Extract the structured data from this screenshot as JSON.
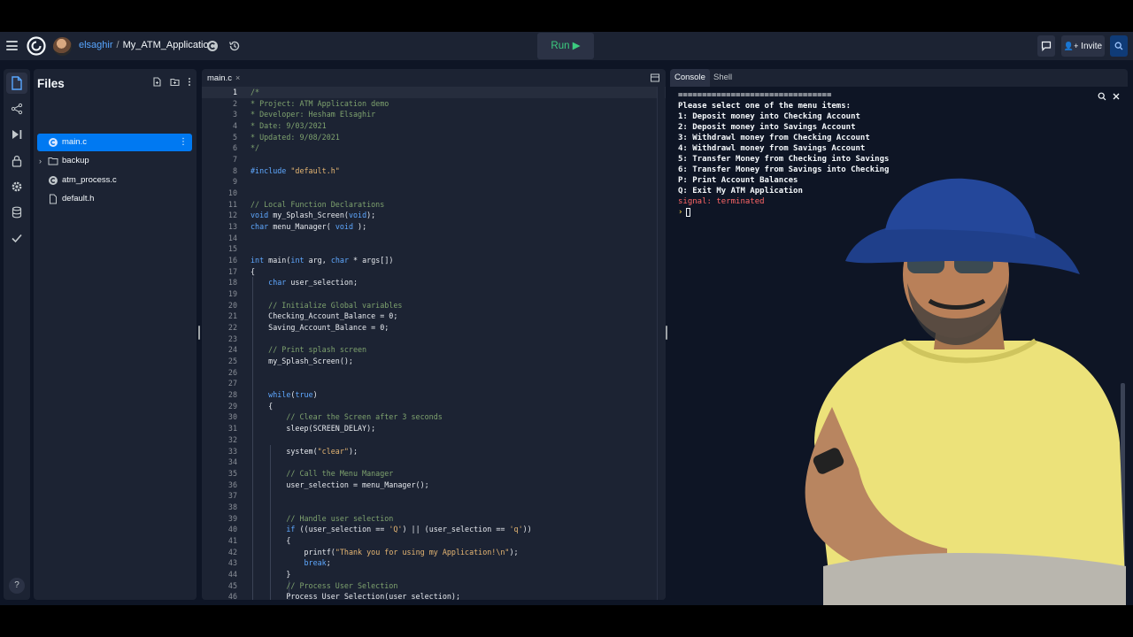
{
  "header": {
    "username": "elsaghir",
    "separator": "/",
    "project": "My_ATM_Application",
    "run_label": "Run ▶",
    "invite_label": "Invite"
  },
  "files": {
    "title": "Files",
    "items": [
      {
        "name": "main.c",
        "type": "c-file",
        "active": true
      },
      {
        "name": "backup",
        "type": "folder",
        "active": false
      },
      {
        "name": "atm_process.c",
        "type": "c-file",
        "active": false
      },
      {
        "name": "default.h",
        "type": "file",
        "active": false
      }
    ]
  },
  "help_label": "?",
  "editor": {
    "tab": "main.c",
    "tab_close": "×",
    "current_line": 1,
    "lines": [
      {
        "n": 1,
        "t": "/*",
        "c": true
      },
      {
        "n": 2,
        "t": "* Project: ATM Application demo",
        "c": true
      },
      {
        "n": 3,
        "t": "* Developer: Hesham Elsaghir",
        "c": true
      },
      {
        "n": 4,
        "t": "* Date: 9/03/2021",
        "c": true
      },
      {
        "n": 5,
        "t": "* Updated: 9/08/2021",
        "c": true
      },
      {
        "n": 6,
        "t": "*/",
        "c": true
      },
      {
        "n": 7,
        "t": ""
      },
      {
        "n": 8,
        "t": "#include \"default.h\"",
        "h": [
          [
            "#include",
            "#5fa8ff"
          ],
          [
            " ",
            ""
          ],
          [
            "\"default.h\"",
            "#e6b673"
          ]
        ]
      },
      {
        "n": 9,
        "t": ""
      },
      {
        "n": 10,
        "t": ""
      },
      {
        "n": 11,
        "t": "// Local Function Declarations",
        "c": true
      },
      {
        "n": 12,
        "t": "void my_Splash_Screen(void);",
        "h": [
          [
            "void",
            "#5fa8ff"
          ],
          [
            " my_Splash_Screen(",
            ""
          ],
          [
            "void",
            "#5fa8ff"
          ],
          [
            ");",
            ""
          ]
        ]
      },
      {
        "n": 13,
        "t": "char menu_Manager( void );",
        "h": [
          [
            "char",
            "#5fa8ff"
          ],
          [
            " menu_Manager( ",
            ""
          ],
          [
            "void",
            "#5fa8ff"
          ],
          [
            " );",
            ""
          ]
        ]
      },
      {
        "n": 14,
        "t": ""
      },
      {
        "n": 15,
        "t": ""
      },
      {
        "n": 16,
        "t": "int main(int arg, char * args[])",
        "h": [
          [
            "int",
            "#5fa8ff"
          ],
          [
            " main(",
            ""
          ],
          [
            "int",
            "#5fa8ff"
          ],
          [
            " arg, ",
            ""
          ],
          [
            "char",
            "#5fa8ff"
          ],
          [
            " * args[])",
            ""
          ]
        ]
      },
      {
        "n": 17,
        "t": "{"
      },
      {
        "n": 18,
        "t": "    char user_selection;",
        "h": [
          [
            "    ",
            ""
          ],
          [
            "char",
            "#5fa8ff"
          ],
          [
            " user_selection;",
            ""
          ]
        ]
      },
      {
        "n": 19,
        "t": ""
      },
      {
        "n": 20,
        "t": "    // Initialize Global variables",
        "c": true
      },
      {
        "n": 21,
        "t": "    Checking_Account_Balance = 0;"
      },
      {
        "n": 22,
        "t": "    Saving_Account_Balance = 0;"
      },
      {
        "n": 23,
        "t": ""
      },
      {
        "n": 24,
        "t": "    // Print splash screen",
        "c": true
      },
      {
        "n": 25,
        "t": "    my_Splash_Screen();"
      },
      {
        "n": 26,
        "t": ""
      },
      {
        "n": 27,
        "t": ""
      },
      {
        "n": 28,
        "t": "    while(true)",
        "h": [
          [
            "    ",
            ""
          ],
          [
            "while",
            "#5fa8ff"
          ],
          [
            "(",
            ""
          ],
          [
            "true",
            "#5fa8ff"
          ],
          [
            ")",
            ""
          ]
        ]
      },
      {
        "n": 29,
        "t": "    {"
      },
      {
        "n": 30,
        "t": "        // Clear the Screen after 3 seconds",
        "c": true
      },
      {
        "n": 31,
        "t": "        sleep(SCREEN_DELAY);"
      },
      {
        "n": 32,
        "t": ""
      },
      {
        "n": 33,
        "t": "        system(\"clear\");",
        "h": [
          [
            "        system(",
            ""
          ],
          [
            "\"clear\"",
            "#e6b673"
          ],
          [
            ");",
            ""
          ]
        ]
      },
      {
        "n": 34,
        "t": ""
      },
      {
        "n": 35,
        "t": "        // Call the Menu Manager",
        "c": true
      },
      {
        "n": 36,
        "t": "        user_selection = menu_Manager();"
      },
      {
        "n": 37,
        "t": ""
      },
      {
        "n": 38,
        "t": ""
      },
      {
        "n": 39,
        "t": "        // Handle user selection",
        "c": true
      },
      {
        "n": 40,
        "t": "        if ((user_selection == 'Q') || (user_selection == 'q'))",
        "h": [
          [
            "        ",
            ""
          ],
          [
            "if",
            "#5fa8ff"
          ],
          [
            " ((user_selection == ",
            ""
          ],
          [
            "'Q'",
            "#e6b673"
          ],
          [
            ") || (user_selection == ",
            ""
          ],
          [
            "'q'",
            "#e6b673"
          ],
          [
            "))",
            ""
          ]
        ]
      },
      {
        "n": 41,
        "t": "        {"
      },
      {
        "n": 42,
        "t": "            printf(\"Thank you for using my Application!\\n\");",
        "h": [
          [
            "            printf(",
            ""
          ],
          [
            "\"Thank you for using my Application!\\n\"",
            "#e6b673"
          ],
          [
            ");",
            ""
          ]
        ]
      },
      {
        "n": 43,
        "t": "            break;",
        "h": [
          [
            "            ",
            ""
          ],
          [
            "break",
            "#5fa8ff"
          ],
          [
            ";",
            ""
          ]
        ]
      },
      {
        "n": 44,
        "t": "        }"
      },
      {
        "n": 45,
        "t": "        // Process User Selection",
        "c": true
      },
      {
        "n": 46,
        "t": "        Process_User_Selection(user_selection);"
      }
    ]
  },
  "console": {
    "tabs": [
      "Console",
      "Shell"
    ],
    "lines": [
      {
        "t": "================================",
        "err": false
      },
      {
        "t": "Please select one of the menu items:",
        "err": false
      },
      {
        "t": "1: Deposit money into Checking Account",
        "err": false
      },
      {
        "t": "2: Deposit money into Savings Account",
        "err": false
      },
      {
        "t": "3: Withdrawl money from Checking Account",
        "err": false
      },
      {
        "t": "4: Withdrawl money from Savings Account",
        "err": false
      },
      {
        "t": "5: Transfer Money from Checking into Savings",
        "err": false
      },
      {
        "t": "6: Transfer Money from Savings into Checking",
        "err": false
      },
      {
        "t": "P: Print Account Balances",
        "err": false
      },
      {
        "t": "Q: Exit My ATM Application",
        "err": false
      },
      {
        "t": "signal: terminated",
        "err": true
      }
    ],
    "prompt": "›"
  },
  "colors": {
    "accent": "#0079f2",
    "run_green": "#3ccb7f",
    "error": "#ff6666"
  }
}
